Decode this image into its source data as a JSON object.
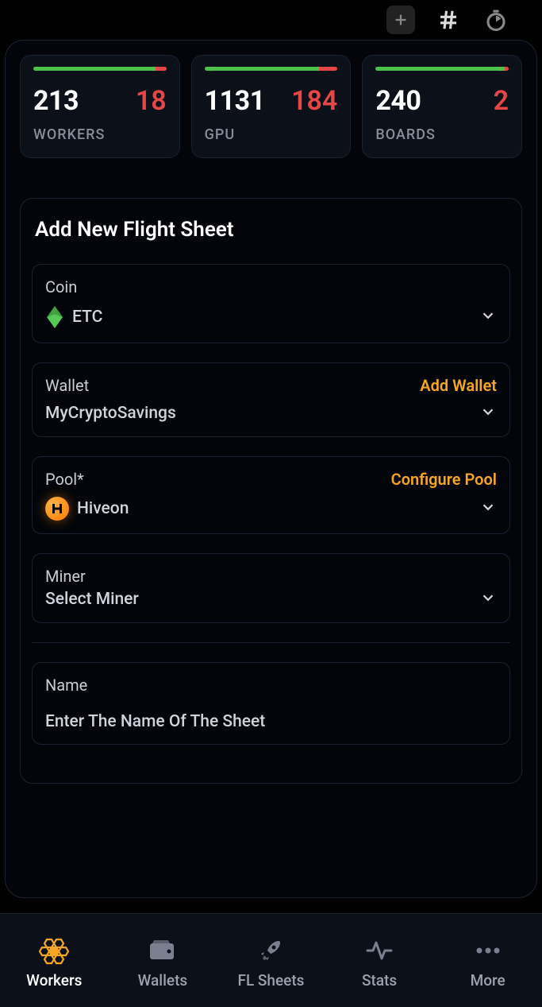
{
  "stats": {
    "workers": {
      "main": "213",
      "sub": "18",
      "label": "WORKERS",
      "greenPct": 92
    },
    "gpu": {
      "main": "1131",
      "sub": "184",
      "label": "GPU",
      "greenPct": 86
    },
    "boards": {
      "main": "240",
      "sub": "2",
      "label": "BOARDS",
      "greenPct": 97
    }
  },
  "panel": {
    "title": "Add New Flight Sheet"
  },
  "coin": {
    "label": "Coin",
    "value": "ETC"
  },
  "wallet": {
    "label": "Wallet",
    "action": "Add Wallet",
    "value": "MyCryptoSavings"
  },
  "pool": {
    "label": "Pool*",
    "action": "Configure Pool",
    "value": "Hiveon"
  },
  "miner": {
    "label": "Miner",
    "value": "Select Miner"
  },
  "name": {
    "label": "Name",
    "placeholder": "Enter The Name Of The Sheet"
  },
  "nav": {
    "workers": "Workers",
    "wallets": "Wallets",
    "flsheets": "FL Sheets",
    "stats": "Stats",
    "more": "More"
  }
}
